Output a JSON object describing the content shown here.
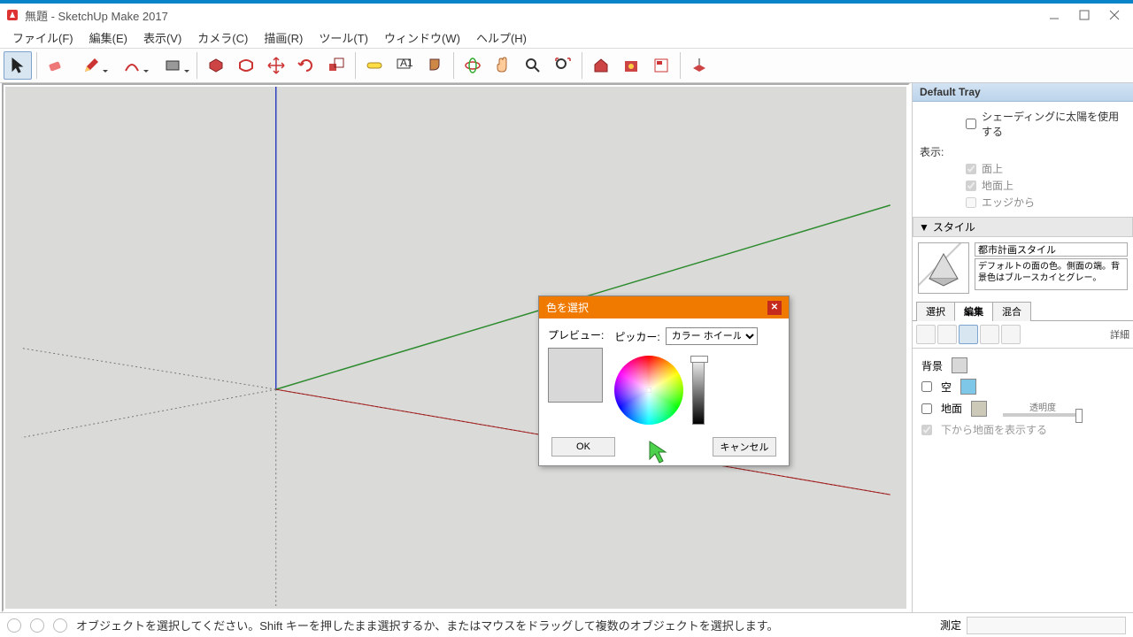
{
  "window": {
    "title": "無題 - SketchUp Make 2017",
    "app_icon": "sketchup"
  },
  "menu": {
    "file": "ファイル(F)",
    "edit": "編集(E)",
    "view": "表示(V)",
    "camera": "カメラ(C)",
    "draw": "描画(R)",
    "tools": "ツール(T)",
    "window": "ウィンドウ(W)",
    "help": "ヘルプ(H)"
  },
  "toolbar_icons": [
    "select",
    "eraser",
    "pencil",
    "arc",
    "rectangle",
    "pushpull",
    "offset",
    "move",
    "rotate",
    "scale",
    "tape",
    "text",
    "paint",
    "orbit",
    "pan",
    "zoom",
    "zoom-extents",
    "warehouse",
    "ext-warehouse",
    "layout",
    "advanced"
  ],
  "tray": {
    "title": "Default Tray",
    "shade_sun": "シェーディングに太陽を使用する",
    "display_label": "表示:",
    "face": "面上",
    "ground": "地面上",
    "edge": "エッジから",
    "style_section": "スタイル",
    "style_name": "都市計画スタイル",
    "style_desc": "デフォルトの面の色。側面の端。背景色はブルースカイとグレー。",
    "tabs": {
      "select": "選択",
      "edit": "編集",
      "mix": "混合"
    },
    "bg_label": "背景",
    "sky_label": "空",
    "ground_label": "地面",
    "trans_label": "透明度",
    "below_label": "下から地面を表示する",
    "adv_label": "詳細"
  },
  "dialog": {
    "title": "色を選択",
    "preview_label": "プレビュー:",
    "picker_label": "ピッカー:",
    "picker_mode": "カラー ホイール",
    "ok": "OK",
    "cancel": "キャンセル"
  },
  "statusbar": {
    "hint": "オブジェクトを選択してください。Shift キーを押したまま選択するか、またはマウスをドラッグして複数のオブジェクトを選択します。",
    "measure_label": "測定"
  }
}
